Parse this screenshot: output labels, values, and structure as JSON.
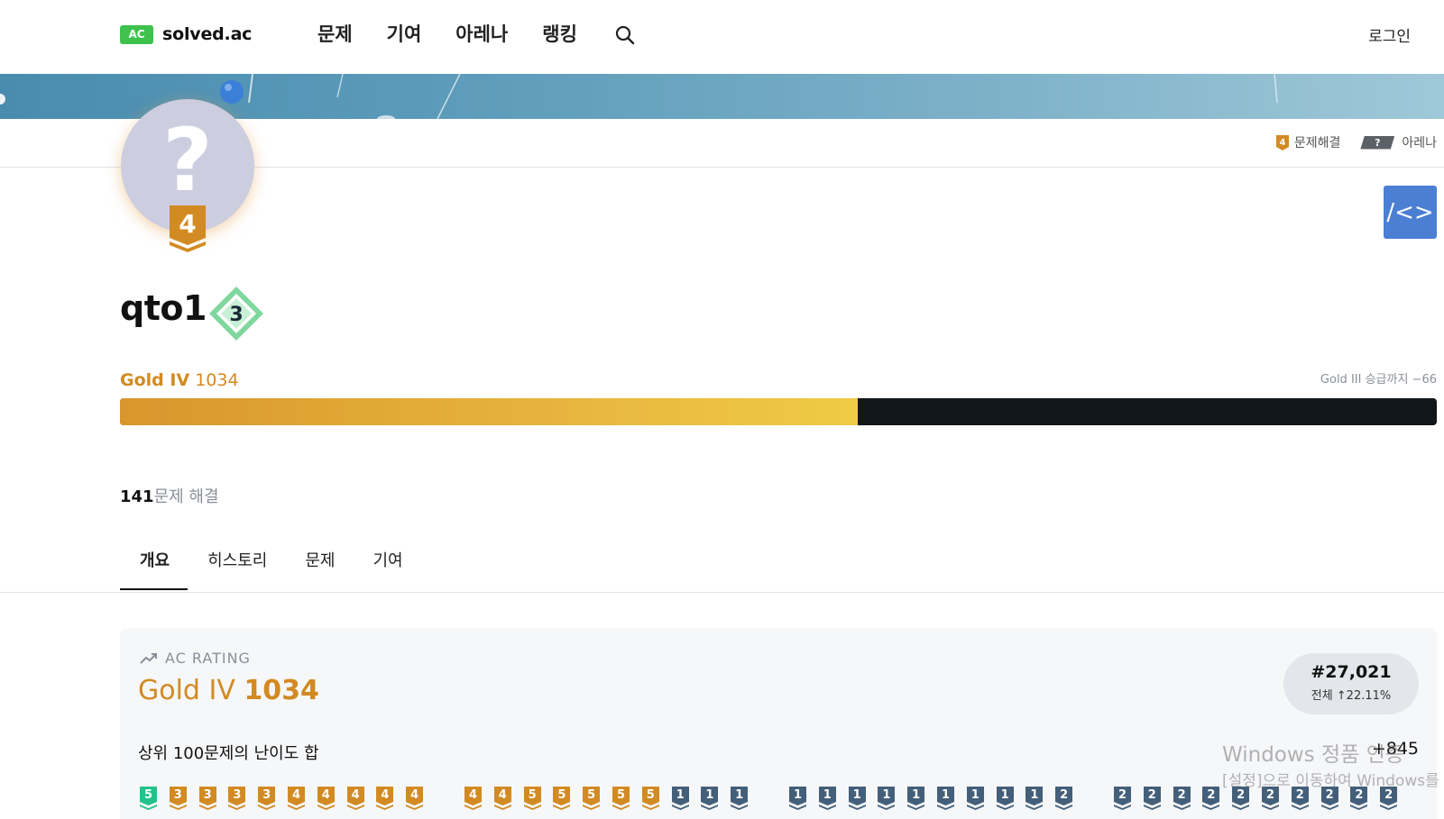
{
  "header": {
    "logo_badge": "AC",
    "logo_text": "solved.ac",
    "nav": [
      "문제",
      "기여",
      "아레나",
      "랭킹"
    ],
    "login": "로그인"
  },
  "profile": {
    "handle": "qto1",
    "avatar_placeholder": "?",
    "tier_level": "4",
    "class_level": "3",
    "problem_tag_level": "4",
    "problem_tag_label": "문제해결",
    "arena_badge": "?",
    "arena_label": "아레나",
    "tier_name": "Gold IV",
    "rating": "1034",
    "next_tier_text": "Gold III 승급까지 −66",
    "progress_fraction": 0.56,
    "solved_count": "141",
    "solved_label": "문제 해결"
  },
  "tabs": [
    "개요",
    "히스토리",
    "문제",
    "기여"
  ],
  "card": {
    "heading": "AC RATING",
    "tier_name": "Gold IV",
    "rating": "1034",
    "rank": "#27,021",
    "rank_sub": "전체 ↑22.11%",
    "description": "상위 100문제의 난이도 합",
    "plus": "+845"
  },
  "watermark": {
    "line1": "Windows 정품 인증",
    "line2": "[설정]으로 이동하여 Windows를"
  },
  "colors": {
    "brand_green": "#3ec24d",
    "gold": "#d28a22",
    "silver": "#435f7a",
    "emerald": "#23c28a",
    "code_button": "#4a7fd4"
  },
  "problem_badges": [
    {
      "tier": "emerald",
      "level": "5"
    },
    {
      "tier": "gold",
      "level": "3"
    },
    {
      "tier": "gold",
      "level": "3"
    },
    {
      "tier": "gold",
      "level": "3"
    },
    {
      "tier": "gold",
      "level": "3"
    },
    {
      "tier": "gold",
      "level": "4"
    },
    {
      "tier": "gold",
      "level": "4"
    },
    {
      "tier": "gold",
      "level": "4"
    },
    {
      "tier": "gold",
      "level": "4"
    },
    {
      "tier": "gold",
      "level": "4"
    },
    {
      "tier": "gold",
      "level": "4"
    },
    {
      "tier": "gold",
      "level": "4"
    },
    {
      "tier": "gold",
      "level": "5"
    },
    {
      "tier": "gold",
      "level": "5"
    },
    {
      "tier": "gold",
      "level": "5"
    },
    {
      "tier": "gold",
      "level": "5"
    },
    {
      "tier": "gold",
      "level": "5"
    },
    {
      "tier": "silver",
      "level": "1"
    },
    {
      "tier": "silver",
      "level": "1"
    },
    {
      "tier": "silver",
      "level": "1"
    },
    {
      "tier": "silver",
      "level": "1"
    },
    {
      "tier": "silver",
      "level": "1"
    },
    {
      "tier": "silver",
      "level": "1"
    },
    {
      "tier": "silver",
      "level": "1"
    },
    {
      "tier": "silver",
      "level": "1"
    },
    {
      "tier": "silver",
      "level": "1"
    },
    {
      "tier": "silver",
      "level": "1"
    },
    {
      "tier": "silver",
      "level": "1"
    },
    {
      "tier": "silver",
      "level": "1"
    },
    {
      "tier": "silver",
      "level": "2"
    },
    {
      "tier": "silver",
      "level": "2"
    },
    {
      "tier": "silver",
      "level": "2"
    },
    {
      "tier": "silver",
      "level": "2"
    },
    {
      "tier": "silver",
      "level": "2"
    },
    {
      "tier": "silver",
      "level": "2"
    },
    {
      "tier": "silver",
      "level": "2"
    },
    {
      "tier": "silver",
      "level": "2"
    },
    {
      "tier": "silver",
      "level": "2"
    },
    {
      "tier": "silver",
      "level": "2"
    },
    {
      "tier": "silver",
      "level": "2"
    }
  ]
}
